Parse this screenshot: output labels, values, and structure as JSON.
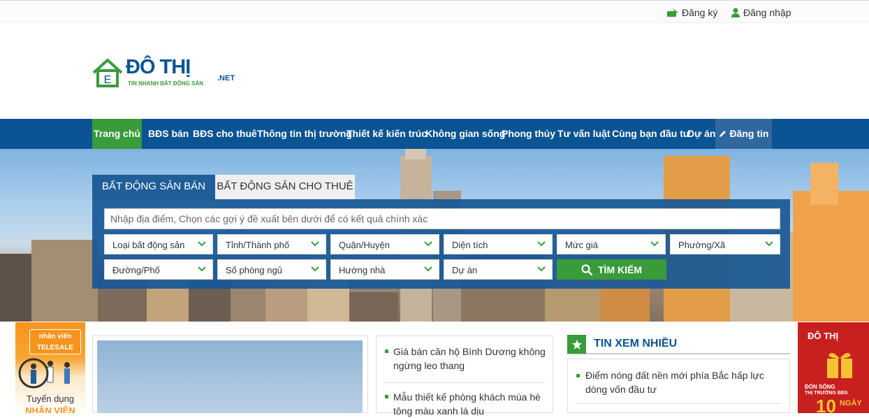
{
  "header": {
    "register_label": "Đăng ký",
    "login_label": "Đăng nhập"
  },
  "logo": {
    "name": "ĐÔ THỊ",
    "suffix": ".NET",
    "tagline": "TIN NHANH BẤT ĐỘNG SẢN",
    "house_letter": "E"
  },
  "nav": {
    "items": [
      {
        "label": "Trang chủ"
      },
      {
        "label": "BĐS bán"
      },
      {
        "label": "BĐS cho thuê"
      },
      {
        "label": "Thông tin thị trường"
      },
      {
        "label": "Thiết kế kiến trúc"
      },
      {
        "label": "Không gian sống"
      },
      {
        "label": "Phong thủy"
      },
      {
        "label": "Tư vấn luật"
      },
      {
        "label": "Cùng bạn đầu tư"
      },
      {
        "label": "Dự án"
      }
    ],
    "post_label": "Đăng tin"
  },
  "search": {
    "tabs": [
      {
        "label": "BẤT ĐỘNG SẢN BÁN"
      },
      {
        "label": "BẤT ĐỘNG SẢN CHO THUÊ"
      }
    ],
    "placeholder": "Nhập địa điểm, Chọn các gợi ý đề xuất bên dưới để có kết quả chính xác",
    "filters_row1": [
      {
        "label": "Loại bất động sản"
      },
      {
        "label": "Tỉnh/Thành phố"
      },
      {
        "label": "Quận/Huyện"
      },
      {
        "label": "Diện tích"
      },
      {
        "label": "Mức giá"
      },
      {
        "label": "Phường/Xã"
      }
    ],
    "filters_row2": [
      {
        "label": "Đường/Phố"
      },
      {
        "label": "Số phòng ngủ"
      },
      {
        "label": "Hướng nhà"
      },
      {
        "label": "Dự án"
      }
    ],
    "button_label": "TÌM KIẾM"
  },
  "ads": {
    "left": {
      "line1": "nhân viên",
      "line2": "TELESALE",
      "line3": "Tuyển dụng",
      "line4": "NHÂN VIÊN"
    },
    "right": {
      "brand": "ĐÔ THỊ",
      "line1": "ĐÓN SÓNG",
      "line2": "THỊ TRƯỜNG BĐS",
      "big": "10",
      "word": "NGÀY"
    }
  },
  "news": {
    "items": [
      {
        "title": "Giá bán căn hộ Bình Dương không ngừng leo thang"
      },
      {
        "title": "Mẫu thiết kế phòng khách mùa hè tông màu xanh lá dịu"
      }
    ]
  },
  "hot_news": {
    "title": "TIN XEM NHIỀU",
    "items": [
      {
        "title": "Điểm nóng đất nền mới phía Bắc hấp lực dòng vốn đầu tư"
      }
    ]
  },
  "colors": {
    "nav_bg": "#0a5494",
    "accent_green": "#3a9b3b",
    "search_panel": "#1f5e98"
  }
}
